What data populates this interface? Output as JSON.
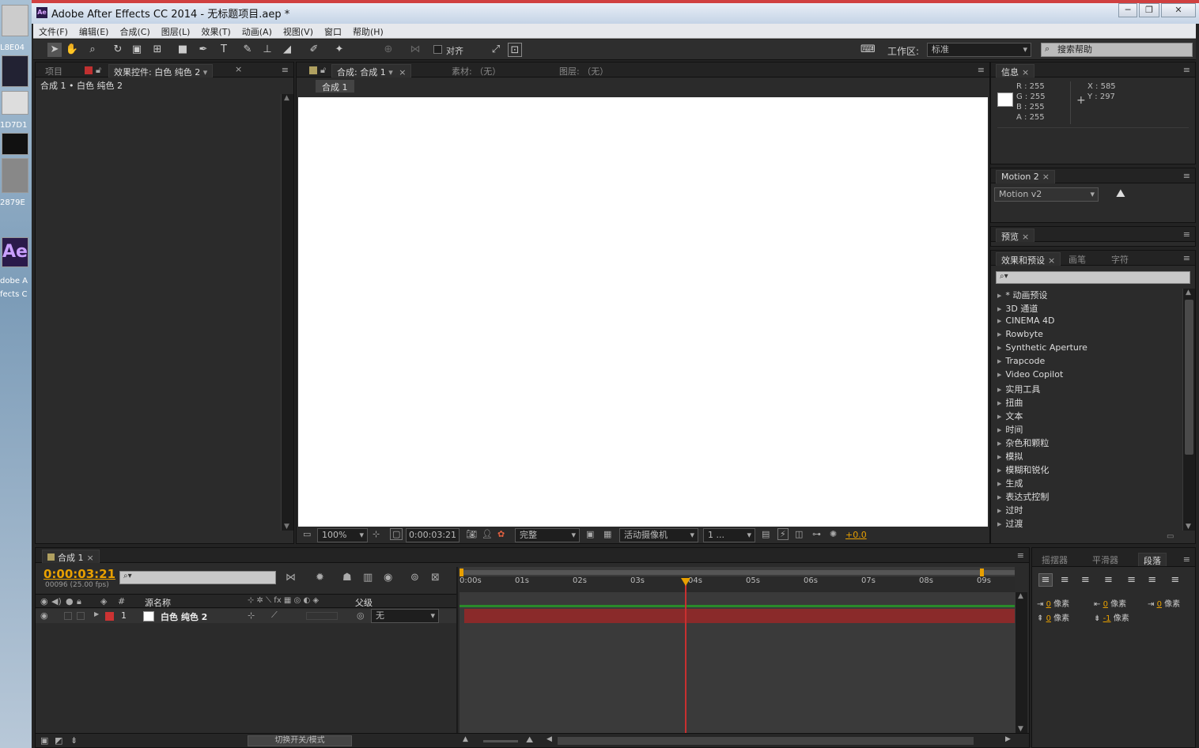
{
  "desktop": {
    "labels": [
      "L8E04",
      "1D7D1",
      "2879E",
      "dobe A",
      "fects C"
    ],
    "ae_icon": "Ae"
  },
  "window": {
    "title": "Adobe After Effects CC 2014 - 无标题项目.aep *",
    "app_icon": "Ae",
    "min": "─",
    "max": "❐",
    "close": "✕"
  },
  "menu": [
    "文件(F)",
    "编辑(E)",
    "合成(C)",
    "图层(L)",
    "效果(T)",
    "动画(A)",
    "视图(V)",
    "窗口",
    "帮助(H)"
  ],
  "toolbar": {
    "align_label": "对齐",
    "workspace_label": "工作区:",
    "workspace_value": "标准",
    "search_placeholder": "搜索帮助"
  },
  "project_panel": {
    "tab_project": "项目",
    "tab_effects": "效果控件: 白色 纯色 2",
    "breadcrumb": "合成 1 • 白色 纯色 2"
  },
  "viewer": {
    "tab_comp": "合成: 合成 1",
    "tab_footage": "素材: （无）",
    "tab_layer": "图层: （无）",
    "comp_chip": "合成 1",
    "zoom": "100%",
    "timecode": "0:00:03:21",
    "quality": "完整",
    "camera": "活动摄像机",
    "views": "1 ...",
    "exposure": "+0.0"
  },
  "info": {
    "tab": "信息",
    "R": "R : 255",
    "G": "G : 255",
    "B": "B : 255",
    "A": "A : 255",
    "X": "X : 585",
    "Y": "Y : 297",
    "swatch": "#ffffff"
  },
  "motion2": {
    "tab": "Motion 2",
    "select": "Motion v2"
  },
  "preview": {
    "tab": "预览"
  },
  "effects": {
    "tab_effects": "效果和预设",
    "tab_brush": "画笔",
    "tab_char": "字符",
    "search_placeholder": "",
    "items": [
      "* 动画预设",
      "3D 通道",
      "CINEMA 4D",
      "Rowbyte",
      "Synthetic Aperture",
      "Trapcode",
      "Video Copilot",
      "实用工具",
      "扭曲",
      "文本",
      "时间",
      "杂色和颗粒",
      "模拟",
      "模糊和锐化",
      "生成",
      "表达式控制",
      "过时",
      "过渡"
    ]
  },
  "timeline": {
    "tab": "合成 1",
    "timecode": "0:00:03:21",
    "frames": "00096 (25.00 fps)",
    "col_source": "源名称",
    "col_parent": "父级",
    "col_num": "#",
    "layer_num": "1",
    "layer_name": "白色 纯色 2",
    "parent_value": "无",
    "toggle_label": "切换开关/模式",
    "ruler": [
      "0:00s",
      "01s",
      "02s",
      "03s",
      "04s",
      "05s",
      "06s",
      "07s",
      "08s",
      "09s"
    ]
  },
  "paragraph": {
    "tab_wiggler": "摇摆器",
    "tab_smoother": "平滑器",
    "tab_paragraph": "段落",
    "indent": [
      {
        "val": "0",
        "unit": "像素"
      },
      {
        "val": "0",
        "unit": "像素"
      },
      {
        "val": "0",
        "unit": "像素"
      },
      {
        "val": "0",
        "unit": "像素"
      },
      {
        "val": "-1",
        "unit": "像素"
      }
    ]
  },
  "colors": {
    "accent": "#e8a000",
    "layer_bar": "#8a2a2a",
    "playhead": "#c83030",
    "layer_label": "#cc3333"
  }
}
